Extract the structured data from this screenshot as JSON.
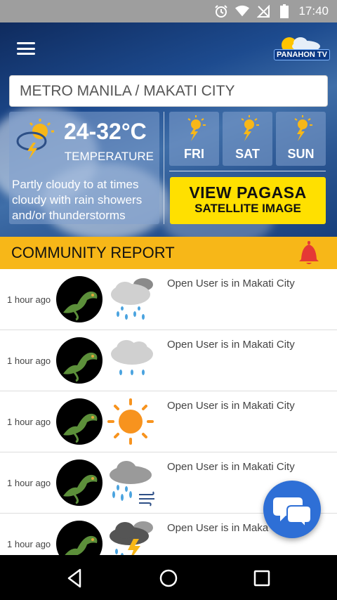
{
  "status_bar": {
    "time": "17:40",
    "icons": [
      "alarm-icon",
      "wifi-icon",
      "no-signal-icon",
      "battery-icon"
    ]
  },
  "header": {
    "menu_icon": "hamburger-menu-icon",
    "logo_text": "PANAHON TV"
  },
  "search": {
    "value": "METRO MANILA / MAKATI CITY"
  },
  "today": {
    "temperature": "24-32°C",
    "temperature_label": "TEMPERATURE",
    "description": "Partly cloudy to at times cloudy with rain showers and/or thunderstorms",
    "icon": "partly-cloudy-thunder-icon"
  },
  "forecast": [
    {
      "day": "FRI",
      "icon": "sun-thunder-icon"
    },
    {
      "day": "SAT",
      "icon": "sun-thunder-icon"
    },
    {
      "day": "SUN",
      "icon": "sun-thunder-icon"
    }
  ],
  "pagasa_button": {
    "line1": "VIEW PAGASA",
    "line2": "SATELLITE IMAGE"
  },
  "community": {
    "title": "COMMUNITY REPORT",
    "bell_icon": "bell-icon"
  },
  "reports": [
    {
      "time": "1 hour ago",
      "text": "Open User is in Makati City",
      "icon": "cloud-rain-icon"
    },
    {
      "time": "1 hour ago",
      "text": "Open User is in Makati City",
      "icon": "cloud-light-rain-icon"
    },
    {
      "time": "1 hour ago",
      "text": "Open User is in Makati City",
      "icon": "sunny-icon"
    },
    {
      "time": "1 hour ago",
      "text": "Open User is in Makati City",
      "icon": "cloud-rain-wind-icon"
    },
    {
      "time": "1 hour ago",
      "text": "Open User is in Maka",
      "icon": "thunderstorm-icon"
    }
  ],
  "chat_button_icon": "chat-bubbles-icon",
  "colors": {
    "accent_yellow": "#ffe000",
    "community_bar": "#f7b718",
    "bell_red": "#e53935",
    "chat_blue": "#2e6fd6",
    "hero_blue": "#1d4b8f"
  }
}
